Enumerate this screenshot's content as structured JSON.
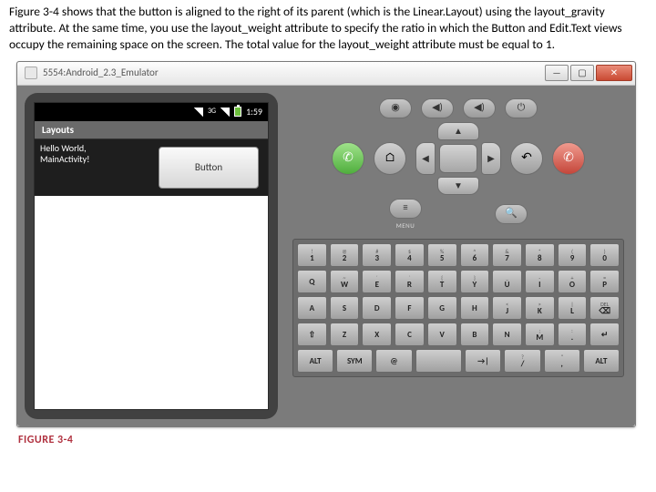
{
  "caption": "Figure 3-4 shows that the button is aligned to the right of its parent (which is the Linear.Layout) using the layout_gravity attribute. At the same time, you use the layout_weight attribute to specify the ratio in which the Button and Edit.Text views occupy the remaining space on the screen. The total value for the layout_weight attribute must be equal to 1.",
  "figure_label": "FIGURE 3-4",
  "window": {
    "title": "5554:Android_2.3_Emulator",
    "min": "—",
    "max": "▢",
    "close": "✕"
  },
  "phone": {
    "time": "1:59",
    "app_title": "Layouts",
    "hello_line1": "Hello World,",
    "hello_line2": "MainActivity!",
    "button_label": "Button"
  },
  "controls": {
    "top": {
      "a": "◉",
      "b": "◀)",
      "c": "◀)",
      "d": "⏻"
    },
    "labels": {
      "home": "HOME",
      "menu": "MENU",
      "back": "BACK",
      "search": "SEARCH"
    },
    "call": "✆",
    "end": "✆"
  },
  "keyboard": {
    "row1": [
      {
        "s": "!",
        "m": "1"
      },
      {
        "s": "@",
        "m": "2"
      },
      {
        "s": "#",
        "m": "3"
      },
      {
        "s": "$",
        "m": "4"
      },
      {
        "s": "%",
        "m": "5"
      },
      {
        "s": "^",
        "m": "6"
      },
      {
        "s": "&",
        "m": "7"
      },
      {
        "s": "*",
        "m": "8"
      },
      {
        "s": "(",
        "m": "9"
      },
      {
        "s": ")",
        "m": "0"
      }
    ],
    "row2": [
      {
        "m": "Q"
      },
      {
        "s": "~",
        "m": "W"
      },
      {
        "s": "´",
        "m": "E"
      },
      {
        "s": "`",
        "m": "R"
      },
      {
        "s": "{",
        "m": "T"
      },
      {
        "s": "}",
        "m": "Y"
      },
      {
        "s": "_",
        "m": "U"
      },
      {
        "s": "-",
        "m": "I"
      },
      {
        "s": "+",
        "m": "O"
      },
      {
        "s": "=",
        "m": "P"
      }
    ],
    "row3": [
      {
        "m": "A"
      },
      {
        "m": "S"
      },
      {
        "m": "D"
      },
      {
        "m": "F"
      },
      {
        "m": "G"
      },
      {
        "m": "H"
      },
      {
        "s": "<",
        "m": "J"
      },
      {
        "s": ">",
        "m": "K"
      },
      {
        "s": "|",
        "m": "L"
      },
      {
        "s": "DEL",
        "m": "⌫"
      }
    ],
    "row4": [
      {
        "m": "⇧"
      },
      {
        "m": "Z"
      },
      {
        "m": "X"
      },
      {
        "m": "C"
      },
      {
        "m": "V"
      },
      {
        "m": "B"
      },
      {
        "m": "N"
      },
      {
        "s": ";",
        "m": "M"
      },
      {
        "s": ":",
        "m": "."
      },
      {
        "m": "↵"
      }
    ],
    "row5": [
      {
        "m": "ALT"
      },
      {
        "m": "SYM"
      },
      {
        "m": "@"
      },
      {
        "m": "",
        "wide": true,
        "space": true
      },
      {
        "m": "→|"
      },
      {
        "s": "?",
        "m": "/"
      },
      {
        "s": "\"",
        "m": ","
      },
      {
        "m": "ALT"
      }
    ]
  }
}
